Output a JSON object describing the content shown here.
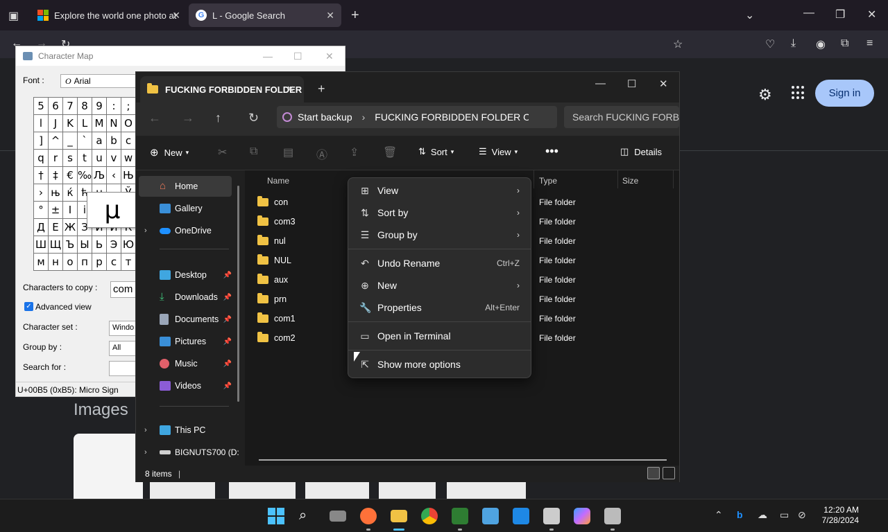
{
  "browser": {
    "tabs": [
      {
        "title": "Explore the world one photo at",
        "active": false
      },
      {
        "title": "L - Google Search",
        "active": true
      }
    ],
    "new_tab_label": "+",
    "sign_in": "Sign in",
    "images_label": "Images"
  },
  "charmap": {
    "title": "Character Map",
    "font_label": "Font :",
    "font_value": "Arial",
    "grid": [
      "5",
      "6",
      "7",
      "8",
      "9",
      ":",
      ";",
      "l",
      "J",
      "K",
      "L",
      "M",
      "N",
      "O",
      "]",
      "^",
      "_",
      "`",
      "a",
      "b",
      "c",
      "q",
      "r",
      "s",
      "t",
      "u",
      "v",
      "w",
      "†",
      "‡",
      "€",
      "‰",
      "Љ",
      "‹",
      "Њ",
      "›",
      "њ",
      "ќ",
      "ћ",
      "џ",
      "",
      "Ў",
      "°",
      "±",
      "І",
      "і",
      "",
      "",
      "",
      "Д",
      "Е",
      "Ж",
      "З",
      "И",
      "Й",
      "К",
      "Ш",
      "Щ",
      "Ъ",
      "Ы",
      "Ь",
      "Э",
      "Ю",
      "м",
      "н",
      "о",
      "п",
      "р",
      "с",
      "т"
    ],
    "zoom_char": "µ",
    "chars_to_copy_label": "Characters to copy :",
    "chars_to_copy_value": "com",
    "advanced_view_label": "Advanced view",
    "character_set_label": "Character set :",
    "character_set_value": "Windo",
    "group_by_label": "Group by :",
    "group_by_value": "All",
    "search_for_label": "Search for :",
    "status": "U+00B5 (0xB5): Micro Sign"
  },
  "explorer": {
    "tab_title": "FUCKING FORBIDDEN FOLDER",
    "address_backup": "Start backup",
    "address_path": "FUCKING FORBIDDEN FOLDER ON \\",
    "search_placeholder": "Search FUCKING FORBID",
    "commands": {
      "new": "New",
      "sort": "Sort",
      "view": "View",
      "details": "Details"
    },
    "sidebar": {
      "home": "Home",
      "gallery": "Gallery",
      "onedrive": "OneDrive",
      "desktop": "Desktop",
      "downloads": "Downloads",
      "documents": "Documents",
      "pictures": "Pictures",
      "music": "Music",
      "videos": "Videos",
      "this_pc": "This PC",
      "drive": "BIGNUTS700 (D:"
    },
    "columns": {
      "name": "Name",
      "type": "Type",
      "size": "Size"
    },
    "rows": [
      {
        "name": "con",
        "type": "File folder"
      },
      {
        "name": "com3",
        "type": "File folder"
      },
      {
        "name": "nul",
        "type": "File folder"
      },
      {
        "name": "NUL",
        "type": "File folder"
      },
      {
        "name": "aux",
        "type": "File folder"
      },
      {
        "name": "prn",
        "type": "File folder"
      },
      {
        "name": "com1",
        "type": "File folder"
      },
      {
        "name": "com2",
        "type": "File folder"
      }
    ],
    "status": "8 items"
  },
  "context_menu": {
    "view": "View",
    "sort_by": "Sort by",
    "group_by": "Group by",
    "undo_rename": "Undo Rename",
    "undo_shortcut": "Ctrl+Z",
    "new": "New",
    "properties": "Properties",
    "properties_shortcut": "Alt+Enter",
    "open_terminal": "Open in Terminal",
    "show_more": "Show more options"
  },
  "taskbar": {
    "time": "12:20 AM",
    "date": "7/28/2024"
  },
  "colors": {
    "accent": "#4cc2ff",
    "folder": "#f0c244",
    "signin_bg": "#a8c7fa"
  }
}
